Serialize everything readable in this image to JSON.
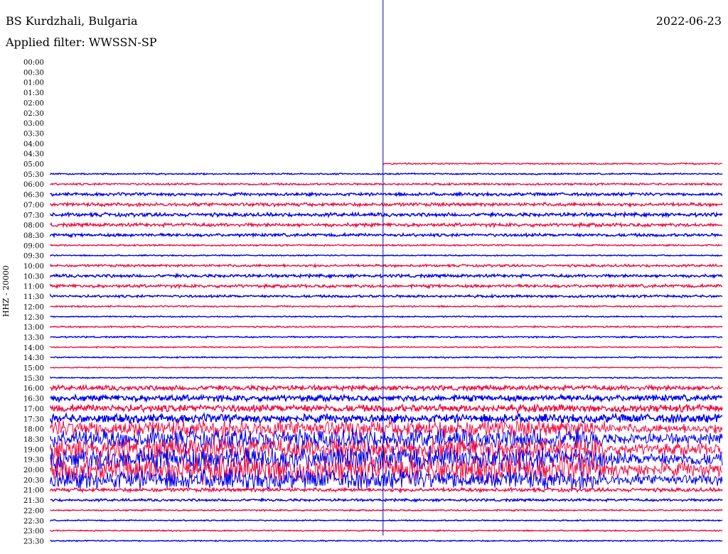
{
  "header": {
    "station": "BS Kurdzhali, Bulgaria",
    "date": "2022-06-23",
    "filter": "Applied filter: WWSSN-SP"
  },
  "chart_data": {
    "type": "line",
    "title": "BS Kurdzhali, Bulgaria",
    "ylabel": "HHZ - 20000",
    "row_labels": [
      "00:00",
      "00:30",
      "01:00",
      "01:30",
      "02:00",
      "02:30",
      "03:00",
      "03:30",
      "04:00",
      "04:30",
      "05:00",
      "05:30",
      "06:00",
      "06:30",
      "07:00",
      "07:30",
      "08:00",
      "08:30",
      "09:00",
      "09:30",
      "10:00",
      "10:30",
      "11:00",
      "11:30",
      "12:00",
      "12:30",
      "13:00",
      "13:30",
      "14:00",
      "14:30",
      "15:00",
      "15:30",
      "16:00",
      "16:30",
      "17:00",
      "17:30",
      "18:00",
      "18:30",
      "19:00",
      "19:30",
      "20:00",
      "20:30",
      "21:00",
      "21:30",
      "22:00",
      "22:30",
      "23:00",
      "23:30"
    ],
    "trace_start_row": 10,
    "trace_start_fraction": 0.495,
    "marker_line_fraction": 0.495,
    "noise_amplitude": [
      0,
      0,
      0,
      0,
      0,
      0,
      0,
      0,
      0,
      0,
      1.2,
      1.2,
      1.6,
      2.5,
      2.8,
      3.0,
      2.8,
      2.5,
      1.2,
      1.0,
      2.0,
      2.5,
      2.5,
      2.0,
      1.2,
      1.0,
      1.2,
      1.2,
      1.0,
      1.0,
      0.8,
      1.0,
      4.0,
      5.0,
      6.0,
      7.0,
      14,
      16,
      18,
      20,
      22,
      16,
      3.0,
      2.0,
      1.2,
      1.0,
      1.0,
      1.0
    ],
    "colors": {
      "even_rows": "#ee1144",
      "odd_rows": "#0000ee",
      "marker": "#0000aa"
    }
  }
}
